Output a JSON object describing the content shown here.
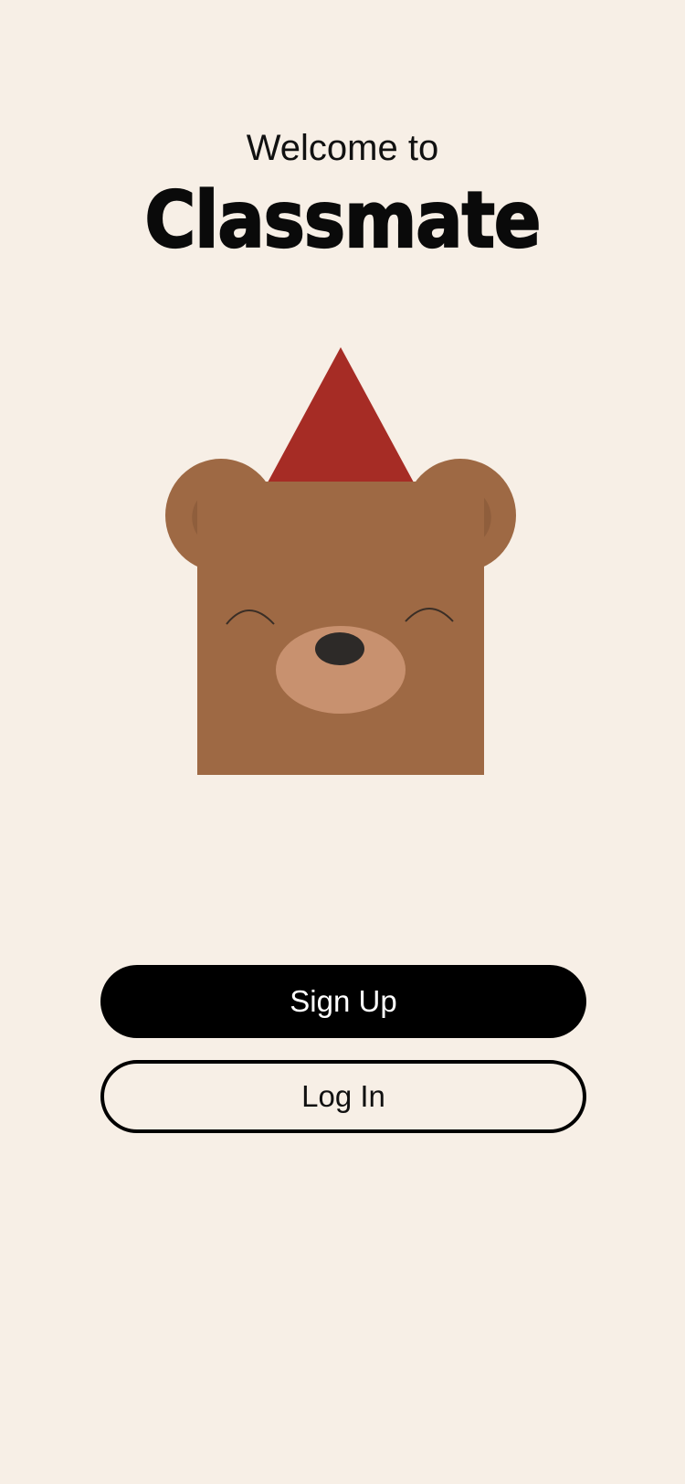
{
  "welcome": {
    "greeting": "Welcome to",
    "app_name": "Classmate"
  },
  "mascot": {
    "icon": "bear-party-hat-icon",
    "colors": {
      "fur": "#9e6944",
      "inner_ear": "#8f5e3c",
      "muzzle": "#c8916f",
      "nose": "#2d2a28",
      "hat": "#a62c25"
    }
  },
  "actions": {
    "signup_label": "Sign Up",
    "login_label": "Log In"
  },
  "theme": {
    "background": "#f7efe6",
    "primary": "#000000"
  }
}
